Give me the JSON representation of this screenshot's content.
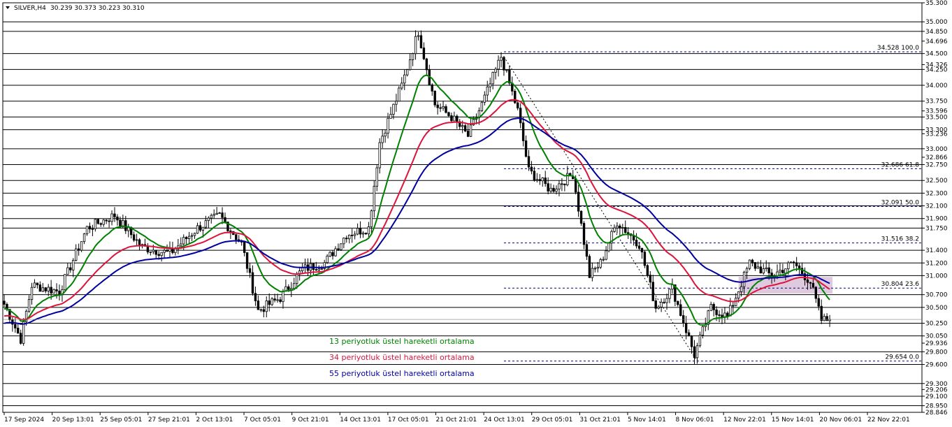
{
  "header": {
    "symbol": "SILVER,H4",
    "ohlc": "30.239 30.373 30.223 30.310"
  },
  "colors": {
    "bull": "#000000",
    "ema13": "#008000",
    "ema34": "#dc143c",
    "ema55": "#0000a0",
    "fib_line": "#000080",
    "box_fill": "#d8bfd8"
  },
  "chart_data": {
    "type": "candlestick",
    "ylim": [
      28.846,
      35.3
    ],
    "grid": false,
    "y_tick_labels": [
      "35.300",
      "35.000",
      "34.850",
      "34.696",
      "34.500",
      "34.326",
      "34.250",
      "34.000",
      "33.750",
      "33.596",
      "33.500",
      "33.300",
      "33.236",
      "33.000",
      "32.866",
      "32.750",
      "32.500",
      "32.300",
      "32.100",
      "31.900",
      "31.750",
      "31.400",
      "31.200",
      "31.000",
      "30.700",
      "30.500",
      "30.250",
      "30.050",
      "29.936",
      "29.800",
      "29.600",
      "29.300",
      "29.206",
      "29.100",
      "28.950",
      "28.846"
    ],
    "horizontal_levels": [
      35.0,
      34.85,
      34.5,
      34.25,
      34.0,
      33.75,
      33.5,
      33.3,
      33.0,
      32.75,
      32.5,
      32.3,
      32.1,
      31.9,
      31.75,
      31.4,
      31.2,
      31.0,
      30.7,
      30.5,
      30.25,
      30.05,
      29.8,
      29.6,
      29.3,
      29.1,
      28.95
    ],
    "current_price": 30.31,
    "x_tick_labels": [
      "17 Sep 2024",
      "20 Sep 13:01",
      "25 Sep 05:01",
      "27 Sep 21:01",
      "2 Oct 13:01",
      "7 Oct 05:01",
      "9 Oct 21:01",
      "14 Oct 13:01",
      "17 Oct 05:01",
      "21 Oct 21:01",
      "24 Oct 13:01",
      "29 Oct 05:01",
      "31 Oct 21:01",
      "5 Nov 14:01",
      "8 Nov 06:01",
      "12 Nov 22:01",
      "15 Nov 14:01",
      "20 Nov 06:01",
      "22 Nov 22:01"
    ],
    "anchors": [
      {
        "i": 0,
        "v": 30.55
      },
      {
        "i": 6,
        "v": 30.0
      },
      {
        "i": 10,
        "v": 30.85
      },
      {
        "i": 20,
        "v": 30.75
      },
      {
        "i": 30,
        "v": 31.75
      },
      {
        "i": 40,
        "v": 31.95
      },
      {
        "i": 50,
        "v": 31.45
      },
      {
        "i": 60,
        "v": 31.35
      },
      {
        "i": 70,
        "v": 31.75
      },
      {
        "i": 78,
        "v": 31.95
      },
      {
        "i": 86,
        "v": 31.5
      },
      {
        "i": 92,
        "v": 30.45
      },
      {
        "i": 100,
        "v": 30.65
      },
      {
        "i": 108,
        "v": 31.1
      },
      {
        "i": 116,
        "v": 31.2
      },
      {
        "i": 124,
        "v": 31.65
      },
      {
        "i": 132,
        "v": 31.75
      },
      {
        "i": 136,
        "v": 33.1
      },
      {
        "i": 144,
        "v": 34.0
      },
      {
        "i": 150,
        "v": 34.85
      },
      {
        "i": 156,
        "v": 33.7
      },
      {
        "i": 162,
        "v": 33.5
      },
      {
        "i": 168,
        "v": 33.2
      },
      {
        "i": 174,
        "v": 33.8
      },
      {
        "i": 180,
        "v": 34.45
      },
      {
        "i": 186,
        "v": 33.6
      },
      {
        "i": 190,
        "v": 32.65
      },
      {
        "i": 198,
        "v": 32.35
      },
      {
        "i": 206,
        "v": 32.6
      },
      {
        "i": 212,
        "v": 31.0
      },
      {
        "i": 216,
        "v": 31.2
      },
      {
        "i": 222,
        "v": 31.85
      },
      {
        "i": 230,
        "v": 31.5
      },
      {
        "i": 236,
        "v": 30.5
      },
      {
        "i": 242,
        "v": 30.8
      },
      {
        "i": 250,
        "v": 29.75
      },
      {
        "i": 256,
        "v": 30.5
      },
      {
        "i": 262,
        "v": 30.35
      },
      {
        "i": 270,
        "v": 31.2
      },
      {
        "i": 278,
        "v": 31.0
      },
      {
        "i": 286,
        "v": 31.2
      },
      {
        "i": 292,
        "v": 30.9
      },
      {
        "i": 296,
        "v": 30.3
      },
      {
        "i": 298,
        "v": 30.3
      }
    ],
    "fibonacci": [
      {
        "price": 34.528,
        "label": "34.528 100.0"
      },
      {
        "price": 32.686,
        "label": "32.686 61.8"
      },
      {
        "price": 32.091,
        "label": "32.091 50.0"
      },
      {
        "price": 31.516,
        "label": "31.516 38.2"
      },
      {
        "price": 30.804,
        "label": "30.804 23.6"
      },
      {
        "price": 29.654,
        "label": "29.654 0.0"
      }
    ],
    "trendline": {
      "from": {
        "i": 181,
        "v": 34.45
      },
      "to": {
        "i": 251,
        "v": 29.654
      }
    },
    "highlight_box": {
      "i_from": 266,
      "i_to": 300,
      "v_from": 30.72,
      "v_to": 30.98
    },
    "series": [
      {
        "name": "13 periyotluk üstel hareketli ortalama",
        "type": "ema",
        "period": 13,
        "color": "#008000"
      },
      {
        "name": "34 periyotluk üstel hareketli ortalama",
        "type": "ema",
        "period": 34,
        "color": "#dc143c"
      },
      {
        "name": "55 periyotluk üstel hareketli ortalama",
        "type": "ema",
        "period": 55,
        "color": "#0000a0"
      }
    ]
  }
}
